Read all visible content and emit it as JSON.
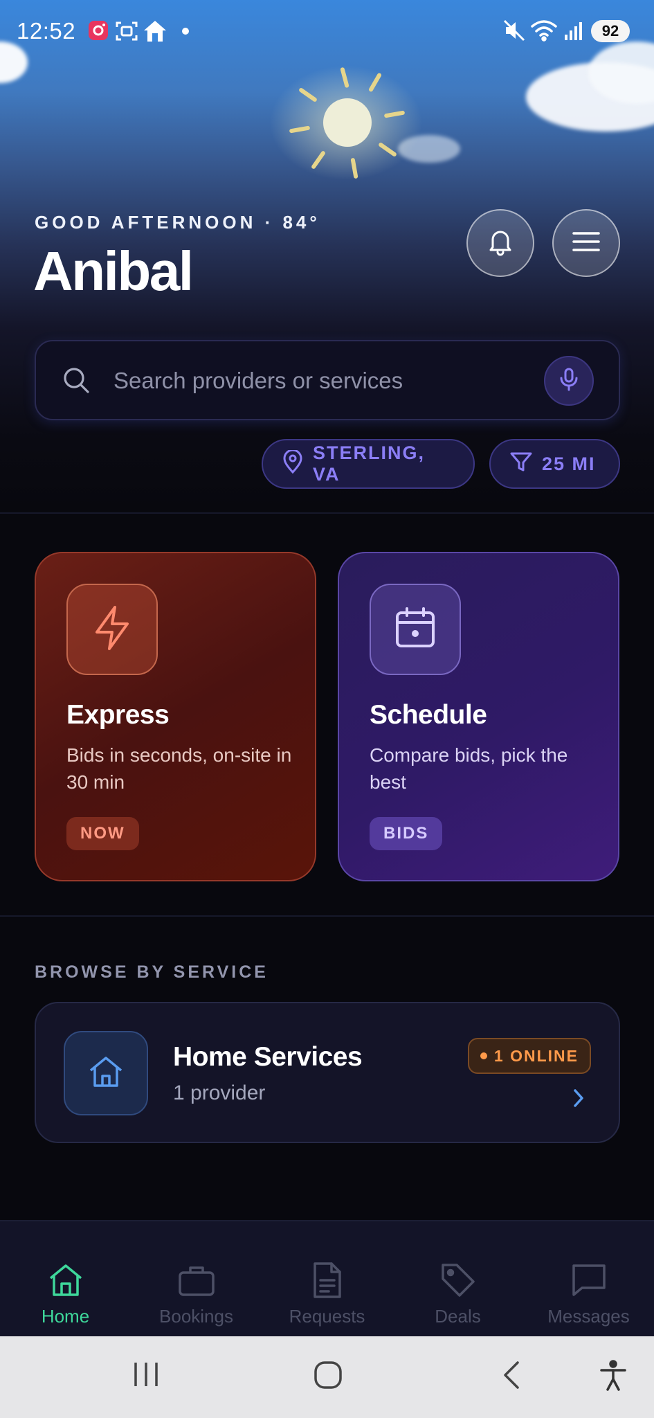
{
  "status_bar": {
    "time": "12:52",
    "battery": "92",
    "icons": [
      "instagram-notification-icon",
      "screenshot-icon",
      "home-notification-icon",
      "dot-icon",
      "mute-icon",
      "wifi-icon",
      "signal-icon"
    ]
  },
  "header": {
    "greeting": "GOOD AFTERNOON  ·  84°",
    "username": "Anibal",
    "buttons": [
      "bell-icon",
      "menu-icon"
    ]
  },
  "search": {
    "placeholder": "Search providers or services"
  },
  "filters": {
    "location": "STERLING, VA",
    "radius": "25 MI"
  },
  "cards": [
    {
      "title": "Express",
      "description": "Bids in seconds, on-site in 30 min",
      "tag": "NOW",
      "icon": "lightning-icon",
      "accent": "#ff9a84"
    },
    {
      "title": "Schedule",
      "description": "Compare bids, pick the best",
      "tag": "BIDS",
      "icon": "calendar-icon",
      "accent": "#d6cbff"
    }
  ],
  "browse": {
    "section_label": "BROWSE BY SERVICE",
    "services": [
      {
        "title": "Home Services",
        "subtitle": "1 provider",
        "badge": "1 ONLINE",
        "icon": "home-icon"
      }
    ]
  },
  "bottom_nav": {
    "items": [
      {
        "label": "Home",
        "icon": "home-icon",
        "active": true
      },
      {
        "label": "Bookings",
        "icon": "briefcase-icon",
        "active": false
      },
      {
        "label": "Requests",
        "icon": "document-icon",
        "active": false
      },
      {
        "label": "Deals",
        "icon": "tag-icon",
        "active": false
      },
      {
        "label": "Messages",
        "icon": "chat-icon",
        "active": false
      }
    ],
    "active_color": "#3ed89b"
  },
  "system_nav": [
    "recents-icon",
    "home-circle-icon",
    "back-icon",
    "accessibility-icon"
  ]
}
